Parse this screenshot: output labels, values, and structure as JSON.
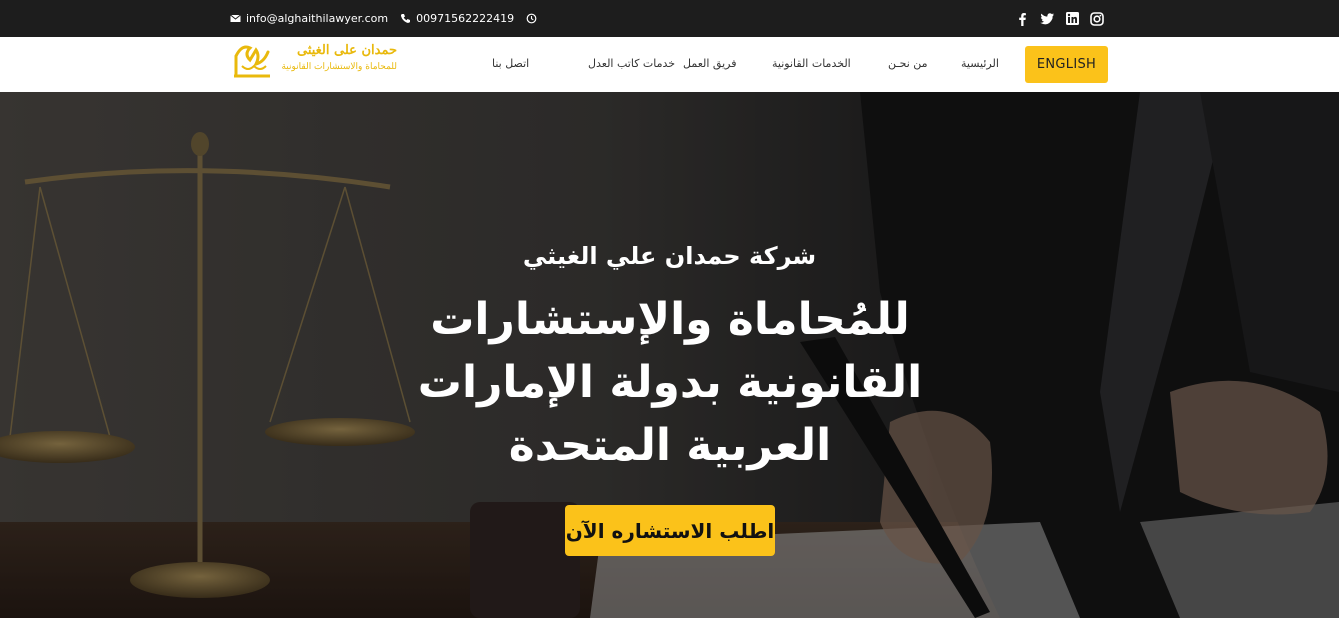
{
  "topbar": {
    "email": "info@alghaithilawyer.com",
    "phone": "00971562222419",
    "icons": {
      "email": "mail-icon",
      "phone": "phone-icon",
      "clock": "clock-icon"
    },
    "social": [
      "facebook-icon",
      "twitter-icon",
      "linkedin-icon",
      "instagram-icon"
    ]
  },
  "logo": {
    "line1": "حمدان على الغيثى",
    "line2": "للمحاماة والاستشارات القانونية"
  },
  "nav": {
    "english_button": "ENGLISH",
    "items": [
      "الرئيسية",
      "من نحـن",
      "الخدمات القانونية",
      "فريق العمل",
      "خدمات كاتب العدل",
      "اتصل بنا"
    ]
  },
  "hero": {
    "subtitle": "شركة حمدان علي الغيثي",
    "title": "للمُحاماة والإستشارات القانونية بدولة الإمارات العربية المتحدة",
    "cta": "اطلب الاستشاره الآن"
  },
  "colors": {
    "accent": "#fbc21a",
    "topbar_bg": "#1d1d1d",
    "nav_bg": "#ffffff",
    "logo_gold": "#e9b90c"
  }
}
